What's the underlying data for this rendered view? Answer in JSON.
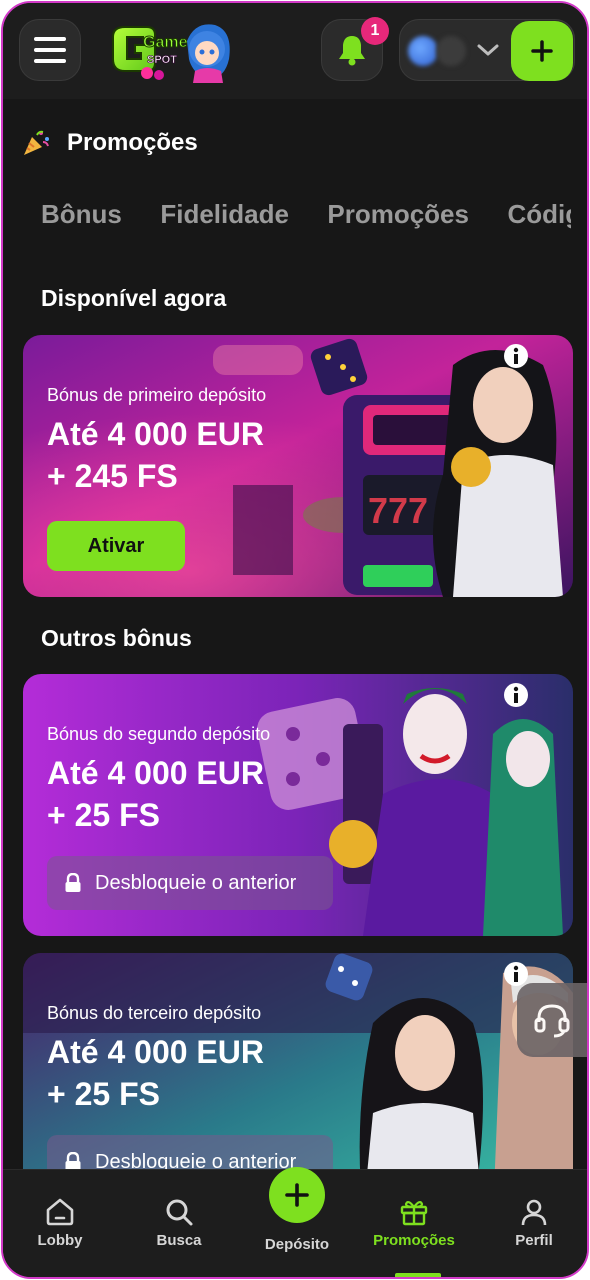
{
  "header": {
    "notification_count": "1",
    "logo_text_top": "Game",
    "logo_text_bottom": "SPOT"
  },
  "page": {
    "title": "Promoções"
  },
  "tabs": [
    "Bônus",
    "Fidelidade",
    "Promoções",
    "Códigos"
  ],
  "sections": {
    "available_now": "Disponível agora",
    "other_bonuses": "Outros bônus"
  },
  "cards": [
    {
      "subtitle": "Bónus de primeiro depósito",
      "amount": "Até 4 000 EUR",
      "extra": "+ 245 FS",
      "action": "Ativar"
    },
    {
      "subtitle": "Bónus do segundo depósito",
      "amount": "Até 4 000 EUR",
      "extra": "+ 25 FS",
      "action": "Desbloqueie o anterior"
    },
    {
      "subtitle": "Bónus do terceiro depósito",
      "amount": "Até 4 000 EUR",
      "extra": "+ 25 FS",
      "action": "Desbloqueie o anterior"
    }
  ],
  "bottom_nav": [
    {
      "label": "Lobby",
      "icon": "home-icon"
    },
    {
      "label": "Busca",
      "icon": "search-icon"
    },
    {
      "label": "Depósito",
      "icon": "plus-icon"
    },
    {
      "label": "Promoções",
      "icon": "gift-icon",
      "active": true
    },
    {
      "label": "Perfil",
      "icon": "user-icon"
    }
  ],
  "colors": {
    "accent": "#7ee01f",
    "badge": "#e6287a",
    "background": "#171717",
    "frame_border": "#d23ac8"
  }
}
